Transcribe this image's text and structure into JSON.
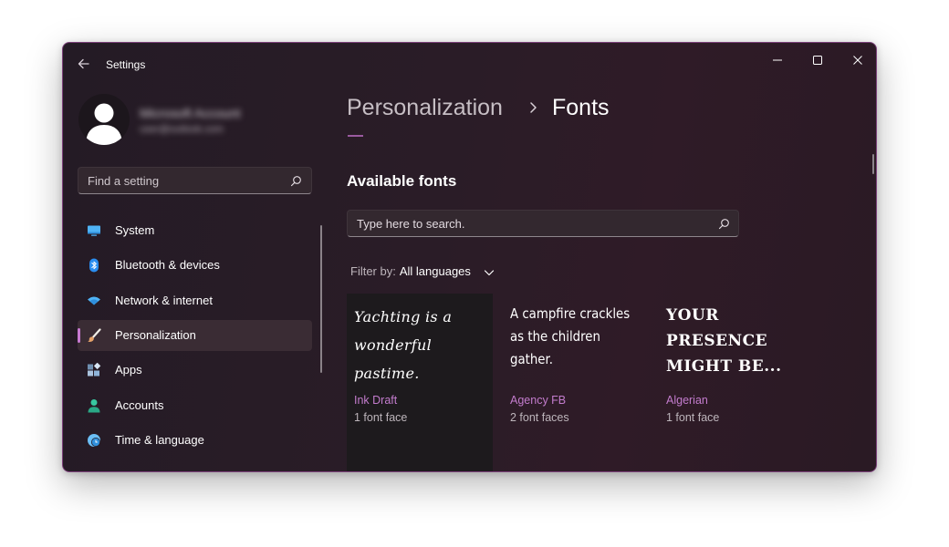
{
  "window": {
    "title": "Settings",
    "controls": {
      "minimize": "minimize-icon",
      "maximize": "maximize-icon",
      "close": "close-icon"
    }
  },
  "profile": {
    "name": "Microsoft Account",
    "email": "user@outlook.com",
    "icon": "person-avatar-icon"
  },
  "sidebar": {
    "search_placeholder": "Find a setting",
    "items": [
      {
        "label": "System",
        "icon": "monitor-icon",
        "color": "#4fb3f6"
      },
      {
        "label": "Bluetooth & devices",
        "icon": "bluetooth-icon",
        "color": "#2a8df0"
      },
      {
        "label": "Network & internet",
        "icon": "wifi-icon",
        "color": "#4fb3f6"
      },
      {
        "label": "Personalization",
        "icon": "paintbrush-icon",
        "color": "#e6a36a",
        "active": true
      },
      {
        "label": "Apps",
        "icon": "apps-icon",
        "color": "#8fb4d9"
      },
      {
        "label": "Accounts",
        "icon": "person-icon",
        "color": "#38c7a0"
      },
      {
        "label": "Time & language",
        "icon": "clock-globe-icon",
        "color": "#6bbef5"
      }
    ]
  },
  "header": {
    "parent": "Personalization",
    "current": "Fonts"
  },
  "main": {
    "section_title": "Available fonts",
    "search_placeholder": "Type here to search.",
    "filter": {
      "label": "Filter by:",
      "value": "All languages"
    },
    "fonts": [
      {
        "preview_lines": [
          "Yachting is a",
          "wonderful pastime."
        ],
        "name": "Ink Draft",
        "faces": "1 font face"
      },
      {
        "preview_lines": [
          "A campfire crackles",
          "as the children",
          "gather."
        ],
        "name": "Agency FB",
        "faces": "2 font faces"
      },
      {
        "preview_lines": [
          "YOUR",
          "PRESENCE",
          "MIGHT BE..."
        ],
        "name": "Algerian",
        "faces": "1 font face"
      }
    ]
  },
  "colors": {
    "accent": "#c37ccd",
    "window_border": "#7a3f78"
  }
}
